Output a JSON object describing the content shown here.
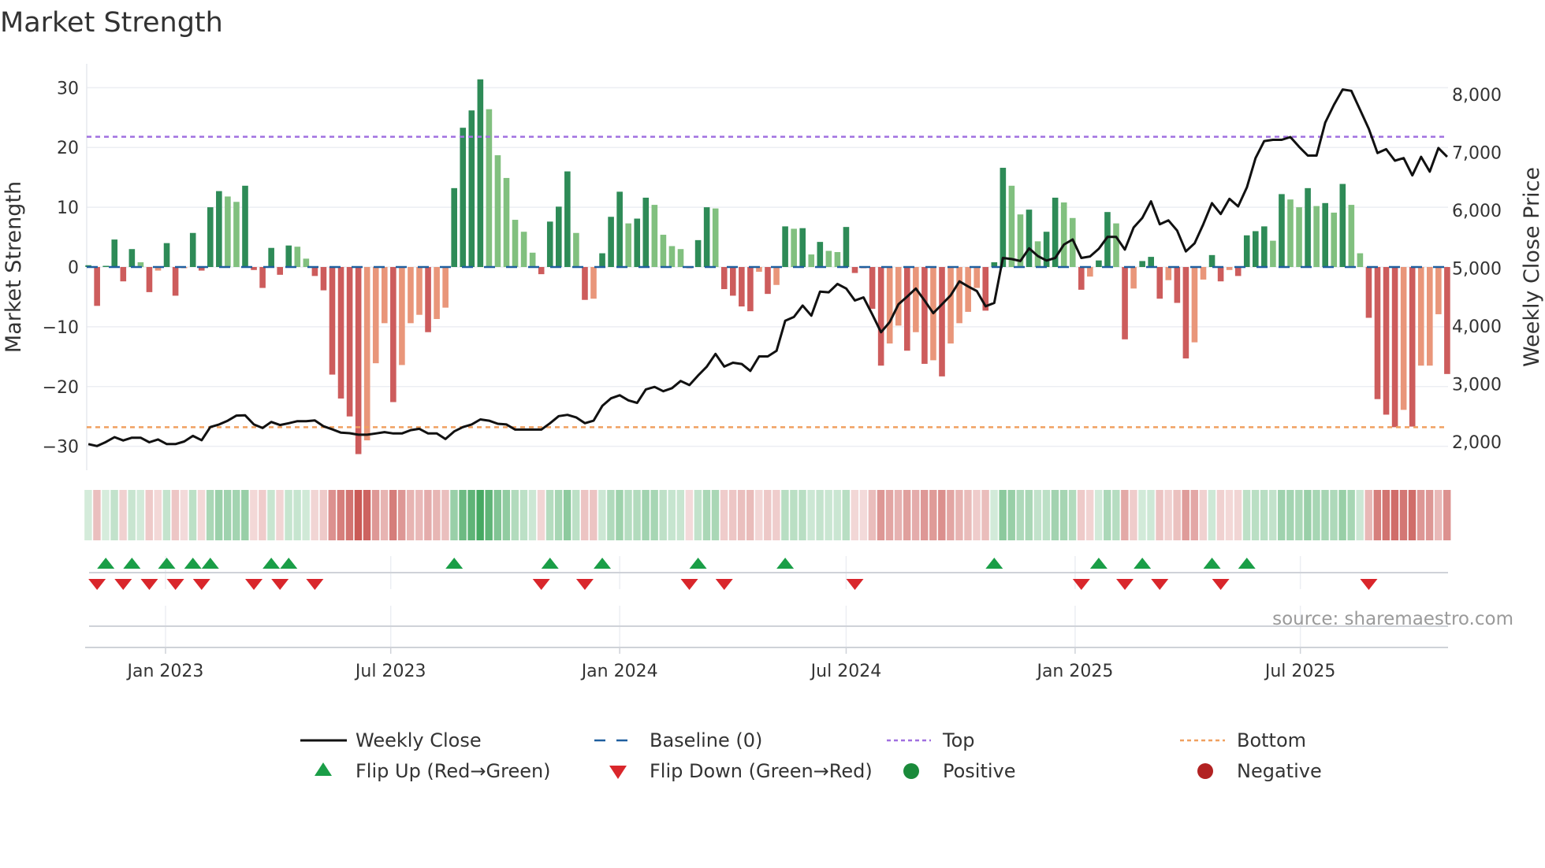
{
  "chart_data": {
    "type": "bar",
    "title": "Market Strength",
    "ylabel": "Market Strength",
    "y2label": "Weekly Close Price",
    "xlabel": "",
    "ylim": [
      -34,
      34
    ],
    "y2lim": [
      1510,
      8530
    ],
    "grid": true,
    "start_date": "2022-10-31",
    "interval_days": 7,
    "y_ticks": [
      {
        "value": 30,
        "label": "30"
      },
      {
        "value": 20,
        "label": "20"
      },
      {
        "value": 10,
        "label": "10"
      },
      {
        "value": 0,
        "label": "0"
      },
      {
        "value": -10,
        "label": "−10"
      },
      {
        "value": -20,
        "label": "−20"
      },
      {
        "value": -30,
        "label": "−30"
      }
    ],
    "y2_ticks": [
      {
        "value": 8000,
        "label": "8,000"
      },
      {
        "value": 7000,
        "label": "7,000"
      },
      {
        "value": 6000,
        "label": "6,000"
      },
      {
        "value": 5000,
        "label": "5,000"
      },
      {
        "value": 4000,
        "label": "4,000"
      },
      {
        "value": 3000,
        "label": "3,000"
      },
      {
        "value": 2000,
        "label": "2,000"
      }
    ],
    "x_ticks": [
      {
        "date": "2023-01-01",
        "label": "Jan 2023"
      },
      {
        "date": "2023-07-01",
        "label": "Jul 2023"
      },
      {
        "date": "2024-01-01",
        "label": "Jan 2024"
      },
      {
        "date": "2024-07-01",
        "label": "Jul 2024"
      },
      {
        "date": "2025-01-01",
        "label": "Jan 2025"
      },
      {
        "date": "2025-07-01",
        "label": "Jul 2025"
      }
    ],
    "top_level": 21.8,
    "bottom_level": -26.8,
    "baseline": 0,
    "colors": {
      "strong_positive": "#2e8b57",
      "weak_positive": "#81c07f",
      "strong_negative": "#cd5c5c",
      "weak_negative": "#e9967a",
      "baseline": "#1f5f9f",
      "top": "#a070e0",
      "bottom": "#f0a060",
      "close": "#111111",
      "flip_up": "#1a9e47",
      "flip_down": "#d9262b",
      "positive": "#1a8a3a",
      "negative": "#b22222"
    },
    "series": [
      {
        "name": "Market Strength",
        "values": [
          0.3,
          -6.5,
          0.2,
          4.6,
          -2.4,
          3.0,
          0.8,
          -4.2,
          -0.6,
          4.0,
          -4.8,
          -0.2,
          5.7,
          -0.6,
          10.0,
          12.7,
          11.8,
          10.9,
          13.6,
          -0.5,
          -3.5,
          3.2,
          -1.3,
          3.6,
          3.4,
          1.4,
          -1.5,
          -3.9,
          -18,
          -22,
          -25,
          -31.3,
          -29,
          -16.1,
          -9.4,
          -22.6,
          -16.4,
          -9.4,
          -8.0,
          -10.9,
          -8.7,
          -6.8,
          13.2,
          23.3,
          26.2,
          31.4,
          26.4,
          18.7,
          14.9,
          7.9,
          5.9,
          2.4,
          -1.2,
          7.6,
          10.1,
          16.0,
          5.7,
          -5.5,
          -5.3,
          2.3,
          8.4,
          12.6,
          7.3,
          8.1,
          11.6,
          10.4,
          5.4,
          3.5,
          3.0,
          -0.2,
          4.5,
          10.0,
          9.8,
          -3.7,
          -4.8,
          -6.6,
          -7.4,
          -0.8,
          -4.5,
          -3.0,
          6.8,
          6.4,
          6.5,
          2.1,
          4.2,
          2.7,
          2.5,
          6.7,
          -1.0,
          -0.1,
          -7.0,
          -16.5,
          -12.8,
          -9.8,
          -14.0,
          -10.9,
          -16.2,
          -15.6,
          -18.3,
          -12.8,
          -9.4,
          -7.5,
          -3.5,
          -7.3,
          0.8,
          16.6,
          13.6,
          8.8,
          9.6,
          4.3,
          5.9,
          11.6,
          10.8,
          8.2,
          -3.8,
          -1.6,
          1.1,
          9.2,
          7.3,
          -12.1,
          -3.6,
          1.0,
          1.7,
          -5.3,
          -2.2,
          -6.0,
          -15.3,
          -12.6,
          -2.1,
          2.0,
          -2.4,
          -0.5,
          -1.5,
          5.3,
          6.0,
          6.8,
          4.4,
          12.2,
          11.3,
          10.0,
          13.2,
          10.2,
          10.7,
          9.1,
          13.9,
          10.4,
          2.3,
          -8.5,
          -22.1,
          -24.7,
          -26.8,
          -23.9,
          -26.7,
          -16.5,
          -16.5,
          -7.9,
          -17.9
        ],
        "shade": [
          "S",
          "S",
          "S",
          "S",
          "S",
          "S",
          "W",
          "S",
          "W",
          "S",
          "S",
          "W",
          "S",
          "S",
          "S",
          "S",
          "W",
          "W",
          "S",
          "S",
          "S",
          "S",
          "S",
          "S",
          "W",
          "W",
          "S",
          "S",
          "S",
          "S",
          "S",
          "S",
          "W",
          "W",
          "W",
          "S",
          "W",
          "W",
          "W",
          "S",
          "W",
          "W",
          "S",
          "S",
          "S",
          "S",
          "W",
          "W",
          "W",
          "W",
          "W",
          "W",
          "S",
          "S",
          "S",
          "S",
          "W",
          "S",
          "W",
          "S",
          "S",
          "S",
          "W",
          "S",
          "S",
          "W",
          "W",
          "W",
          "W",
          "S",
          "S",
          "S",
          "W",
          "S",
          "S",
          "S",
          "S",
          "W",
          "S",
          "W",
          "S",
          "W",
          "S",
          "W",
          "S",
          "W",
          "W",
          "S",
          "S",
          "S",
          "S",
          "S",
          "W",
          "W",
          "S",
          "W",
          "S",
          "W",
          "S",
          "W",
          "W",
          "W",
          "W",
          "S",
          "S",
          "S",
          "W",
          "W",
          "S",
          "W",
          "S",
          "S",
          "W",
          "W",
          "S",
          "W",
          "S",
          "S",
          "W",
          "S",
          "W",
          "S",
          "S",
          "S",
          "W",
          "S",
          "S",
          "W",
          "W",
          "S",
          "S",
          "W",
          "S",
          "S",
          "S",
          "S",
          "W",
          "S",
          "W",
          "W",
          "S",
          "W",
          "S",
          "W",
          "S",
          "W",
          "W",
          "S",
          "S",
          "S",
          "S",
          "W",
          "S",
          "W",
          "W",
          "W",
          "S"
        ]
      },
      {
        "name": "Weekly Close",
        "values": [
          1962,
          1927,
          1997,
          2081,
          2024,
          2072,
          2072,
          1993,
          2042,
          1962,
          1962,
          2006,
          2103,
          2028,
          2256,
          2300,
          2366,
          2454,
          2458,
          2300,
          2239,
          2344,
          2291,
          2322,
          2357,
          2357,
          2370,
          2269,
          2216,
          2159,
          2150,
          2124,
          2124,
          2146,
          2168,
          2146,
          2146,
          2203,
          2225,
          2146,
          2146,
          2049,
          2181,
          2256,
          2300,
          2388,
          2366,
          2313,
          2300,
          2212,
          2212,
          2212,
          2212,
          2322,
          2445,
          2467,
          2423,
          2322,
          2366,
          2621,
          2752,
          2805,
          2717,
          2673,
          2906,
          2950,
          2875,
          2928,
          3051,
          2981,
          3147,
          3300,
          3520,
          3300,
          3367,
          3345,
          3226,
          3476,
          3476,
          3573,
          4091,
          4157,
          4355,
          4179,
          4596,
          4583,
          4728,
          4649,
          4442,
          4495,
          4201,
          3894,
          4069,
          4377,
          4508,
          4649,
          4442,
          4223,
          4377,
          4530,
          4772,
          4684,
          4605,
          4342,
          4399,
          5176,
          5158,
          5123,
          5342,
          5211,
          5132,
          5176,
          5408,
          5496,
          5176,
          5202,
          5334,
          5540,
          5540,
          5320,
          5702,
          5869,
          6155,
          5759,
          5825,
          5650,
          5290,
          5430,
          5759,
          6124,
          5935,
          6198,
          6067,
          6396,
          6901,
          7195,
          7217,
          7217,
          7265,
          7098,
          6945,
          6945,
          7515,
          7823,
          8086,
          8064,
          7735,
          7406,
          6989,
          7055,
          6857,
          6901,
          6602,
          6923,
          6668,
          7076,
          6923
        ]
      }
    ],
    "flip_up_indices": [
      2,
      5,
      9,
      12,
      14,
      21,
      23,
      42,
      53,
      59,
      70,
      80,
      104,
      116,
      121,
      129,
      133
    ],
    "flip_down_indices": [
      1,
      4,
      7,
      10,
      13,
      19,
      22,
      26,
      52,
      57,
      69,
      73,
      88,
      114,
      119,
      123,
      130,
      147
    ],
    "legend_position": "bottom",
    "legend": [
      {
        "label": "Weekly Close",
        "symbol": "solid-line"
      },
      {
        "label": "Baseline (0)",
        "symbol": "dashed-line"
      },
      {
        "label": "Top",
        "symbol": "dotted-line"
      },
      {
        "label": "Bottom",
        "symbol": "dotted-line"
      },
      {
        "label": "Flip Up (Red→Green)",
        "symbol": "triangle-up"
      },
      {
        "label": "Flip Down (Green→Red)",
        "symbol": "triangle-down"
      },
      {
        "label": "Positive",
        "symbol": "circle"
      },
      {
        "label": "Negative",
        "symbol": "circle"
      }
    ],
    "annotation": "source: sharemaestro.com"
  }
}
